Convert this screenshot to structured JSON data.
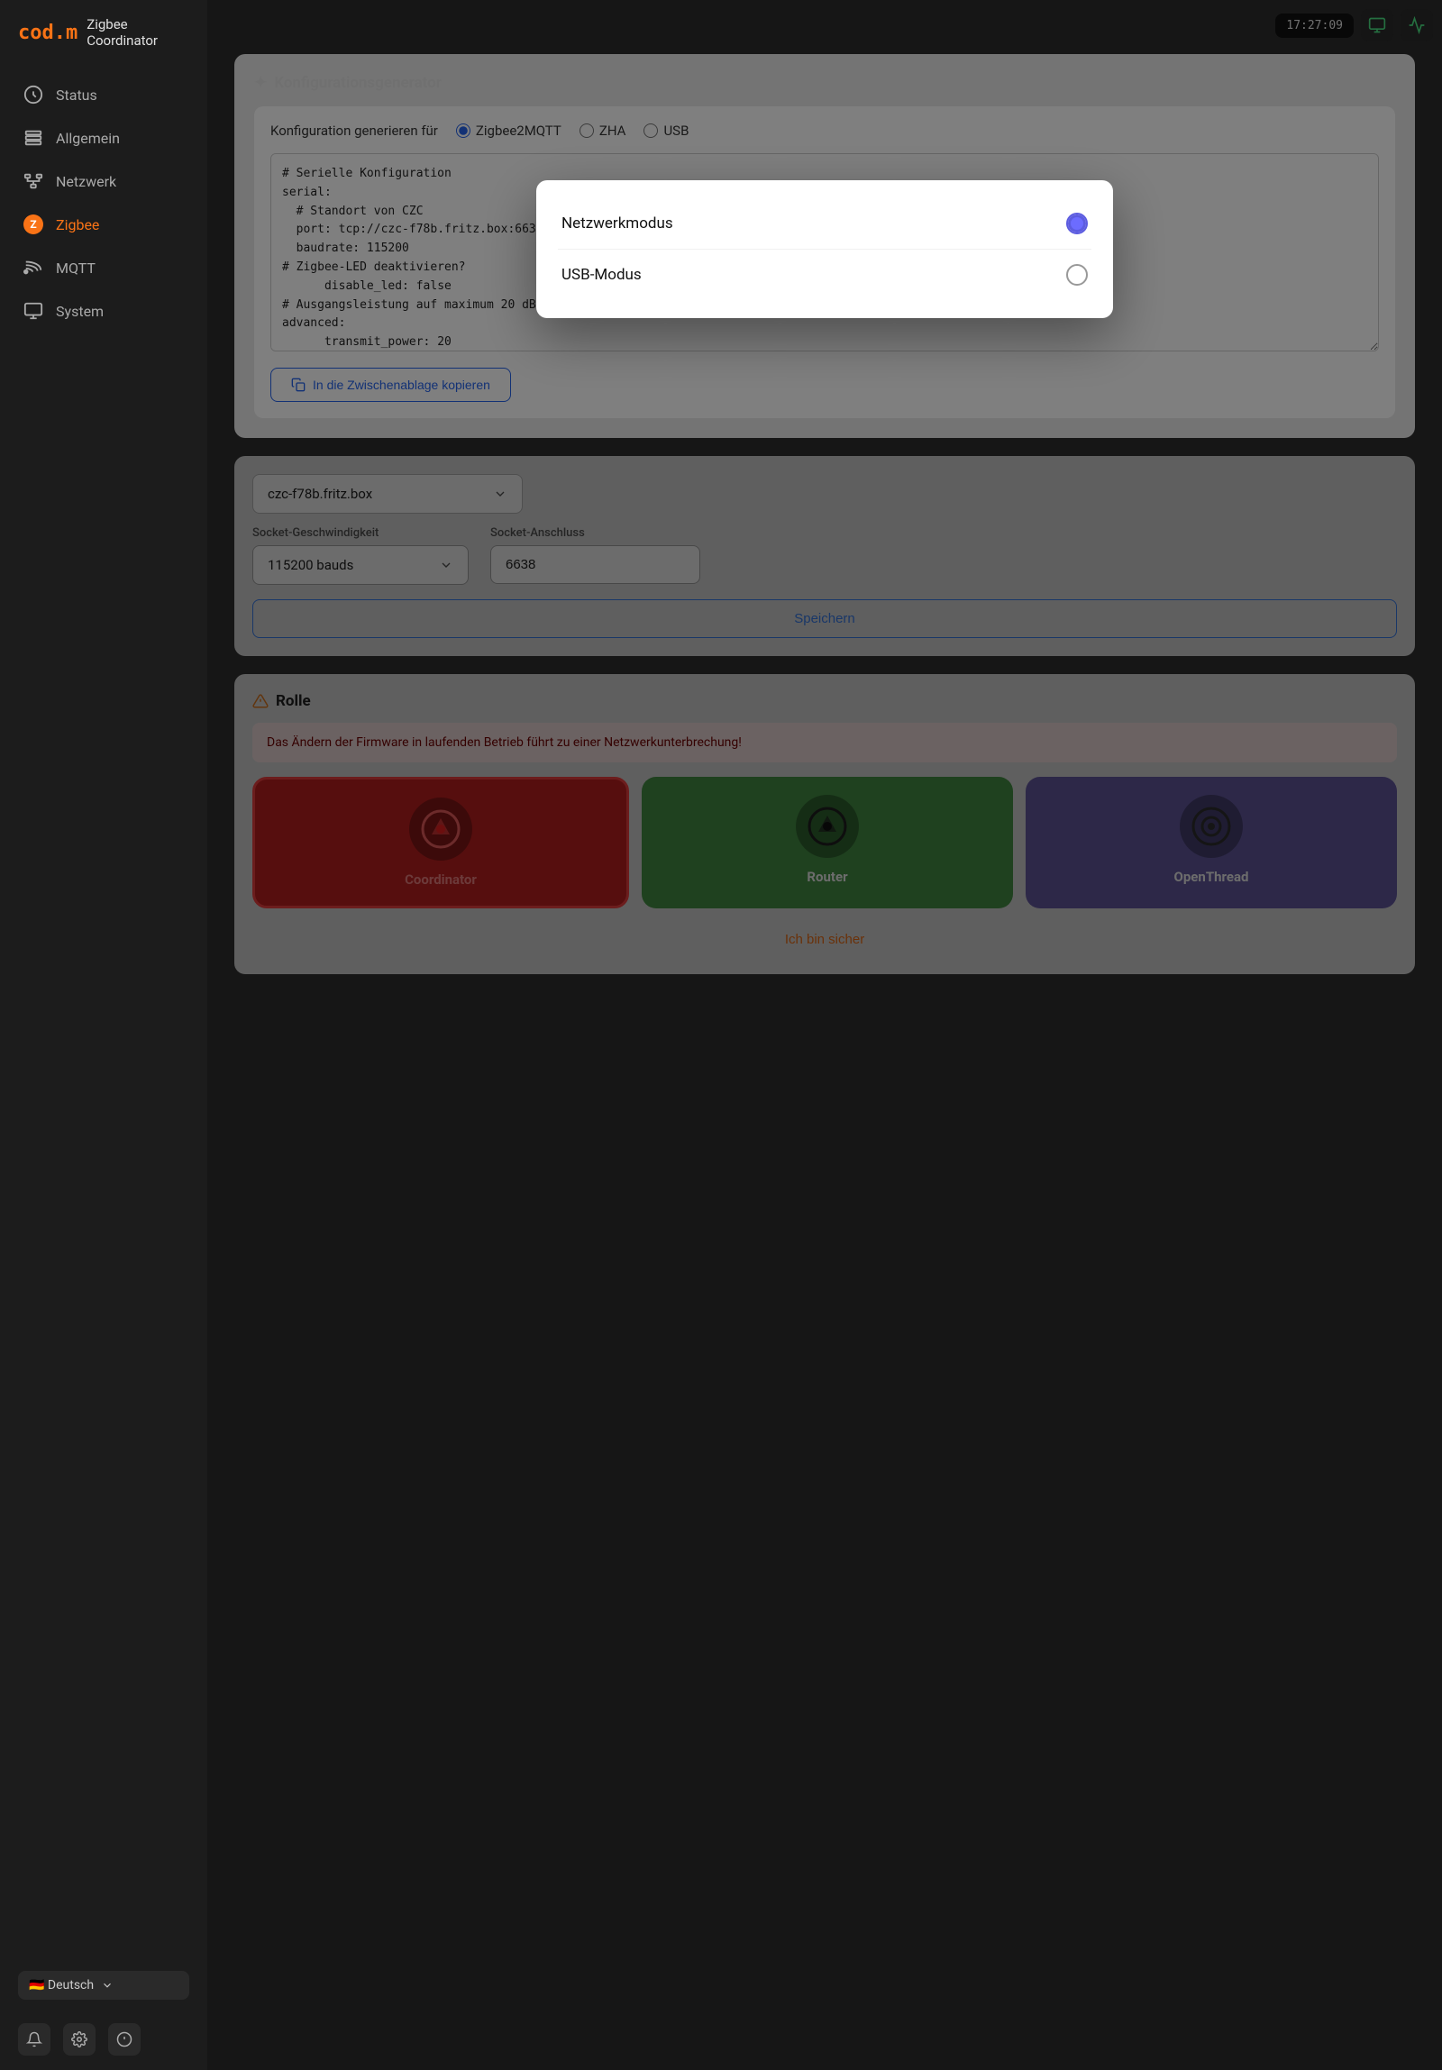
{
  "app": {
    "logo": "cod.m",
    "title": "Zigbee Coordinator",
    "clock": "17:27:09"
  },
  "sidebar": {
    "items": [
      {
        "id": "status",
        "label": "Status"
      },
      {
        "id": "allgemein",
        "label": "Allgemein"
      },
      {
        "id": "netzwerk",
        "label": "Netzwerk"
      },
      {
        "id": "zigbee",
        "label": "Zigbee",
        "active": true
      },
      {
        "id": "mqtt",
        "label": "MQTT"
      },
      {
        "id": "system",
        "label": "System"
      }
    ],
    "language": "🇩🇪 Deutsch"
  },
  "config_generator": {
    "section_title": "Konfigurationsgenerator",
    "label_prefix": "Konfiguration generieren für",
    "tabs": [
      "Zigbee2MQTT",
      "ZHA",
      "USB"
    ],
    "active_tab": "Zigbee2MQTT",
    "config_text": "# Serielle Konfiguration\nserial:\n  # Standort von CZC\n  port: tcp://czc-f78b.fritz.box:6638\n  baudrate: 115200\n  # Zigbee-LED deaktivieren?\n      disable_led: false\n  # Ausgangsleistung auf maximum 20 dBm einstellen\nadvanced:\n      transmit_power: 20",
    "copy_button_label": "In die Zwischenablage kopieren"
  },
  "mode_modal": {
    "option1_label": "Netzwerkmodus",
    "option1_selected": true,
    "option2_label": "USB-Modus",
    "option2_selected": false
  },
  "connection_settings": {
    "socket_speed_label": "Socket-Geschwindigkeit",
    "socket_speed_value": "115200 bauds",
    "socket_port_label": "Socket-Anschluss",
    "socket_port_value": "6638",
    "save_button_label": "Speichern"
  },
  "role_section": {
    "section_title": "Rolle",
    "warning_text": "Das Ändern der Firmware in laufenden Betrieb führt zu einer Netzwerkunterbrechung!",
    "roles": [
      {
        "id": "coordinator",
        "label": "Coordinator",
        "color": "#cc2222",
        "active": true
      },
      {
        "id": "router",
        "label": "Router",
        "color": "#4a9a4a",
        "active": false
      },
      {
        "id": "openthread",
        "label": "OpenThread",
        "color": "#6a5faa",
        "active": false
      }
    ],
    "confirm_button_label": "Ich bin sicher"
  }
}
